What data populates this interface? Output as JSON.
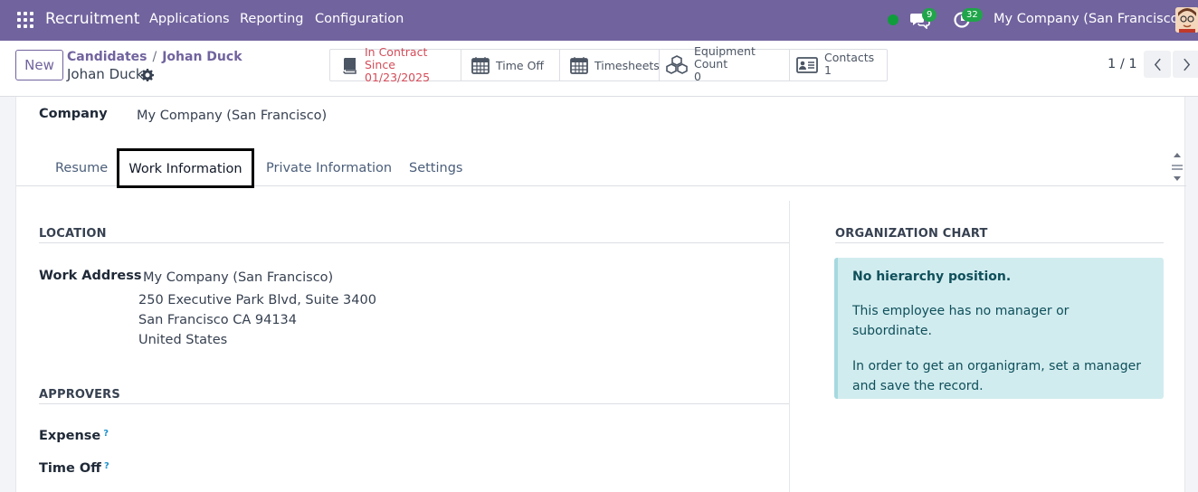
{
  "navbar": {
    "app_name": "Recruitment",
    "menus": [
      "Applications",
      "Reporting",
      "Configuration"
    ],
    "chat_count": "9",
    "activity_count": "32",
    "company": "My Company (San Francisco)"
  },
  "control": {
    "new_label": "New",
    "breadcrumb": [
      "Candidates",
      "Johan Duck"
    ],
    "record_title": "Johan Duck",
    "smart_buttons": {
      "contract": {
        "label": "In Contract Since",
        "value": "01/23/2025"
      },
      "time_off": {
        "label": "Time Off"
      },
      "timesheets": {
        "label": "Timesheets"
      },
      "equipment": {
        "label": "Equipment Count",
        "value": "0"
      },
      "contacts": {
        "label": "Contacts",
        "value": "1"
      }
    },
    "pager": "1 / 1"
  },
  "form": {
    "company_label": "Company",
    "company_value": "My Company (San Francisco)",
    "tabs": [
      "Resume",
      "Work Information",
      "Private Information",
      "Settings"
    ],
    "location": {
      "title": "LOCATION",
      "work_address_label": "Work Address",
      "address_lines": [
        "My Company (San Francisco)",
        "250 Executive Park Blvd, Suite 3400",
        "San Francisco CA 94134",
        "United States"
      ]
    },
    "approvers": {
      "title": "APPROVERS",
      "expense_label": "Expense",
      "time_off_label": "Time Off",
      "help_mark": "?"
    },
    "org_chart": {
      "title": "ORGANIZATION CHART",
      "heading": "No hierarchy position.",
      "line1": "This employee has no manager or subordinate.",
      "line2": "In order to get an organigram, set a manager and save the record."
    }
  },
  "colors": {
    "brand": "#71639e",
    "badge": "#20a54a",
    "status_dot": "#0f9d3c",
    "contract_red": "#d44c59",
    "info_bg": "#d1ecef"
  }
}
